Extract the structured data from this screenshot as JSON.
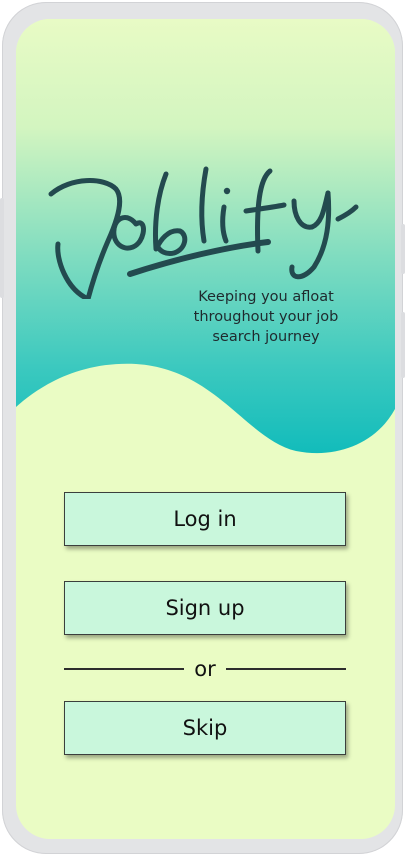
{
  "app": {
    "name": "Joblify",
    "logo_text": "Joblify",
    "tagline": "Keeping you afloat throughout your job search journey"
  },
  "actions": {
    "login_label": "Log in",
    "signup_label": "Sign up",
    "divider_label": "or",
    "skip_label": "Skip"
  },
  "colors": {
    "screen_background": "#eafcc4",
    "hero_gradient_top": "#e8fbc5",
    "hero_gradient_bottom": "#12bcbb",
    "button_fill": "#c9f7dc",
    "logo_ink": "#234a4f"
  },
  "icons": {
    "logo": "handwritten-wordmark"
  }
}
